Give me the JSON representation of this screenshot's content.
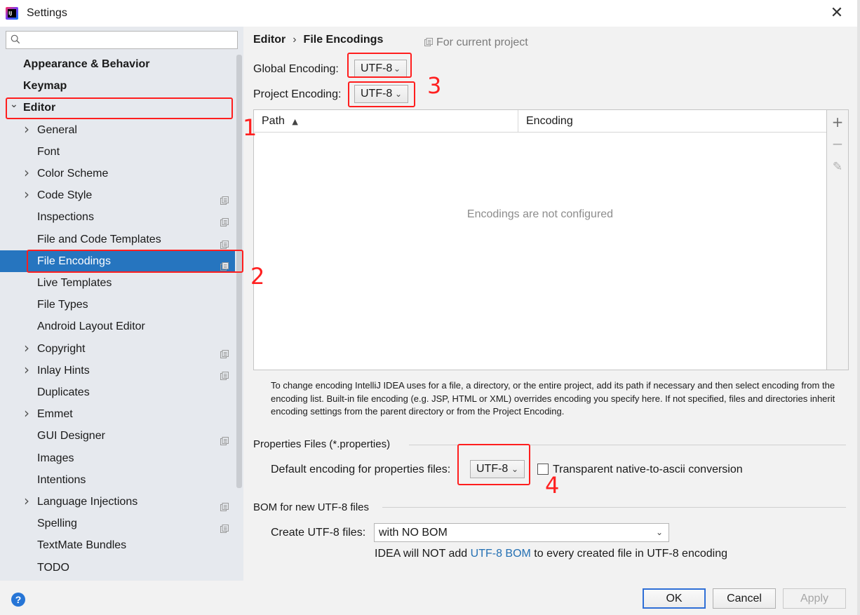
{
  "window": {
    "title": "Settings",
    "logo_text": "IJ"
  },
  "sidebar": {
    "search_placeholder": "",
    "items": [
      {
        "label": "Appearance & Behavior",
        "bold": true,
        "level": 0,
        "chevron": ""
      },
      {
        "label": "Keymap",
        "bold": true,
        "level": 0,
        "chevron": ""
      },
      {
        "label": "Editor",
        "bold": true,
        "level": 0,
        "chevron": "down"
      },
      {
        "label": "General",
        "level": 1,
        "chevron": "right"
      },
      {
        "label": "Font",
        "level": 1,
        "chevron": ""
      },
      {
        "label": "Color Scheme",
        "level": 1,
        "chevron": "right"
      },
      {
        "label": "Code Style",
        "level": 1,
        "chevron": "right",
        "project": true
      },
      {
        "label": "Inspections",
        "level": 1,
        "chevron": "",
        "project": true
      },
      {
        "label": "File and Code Templates",
        "level": 1,
        "chevron": "",
        "project": true
      },
      {
        "label": "File Encodings",
        "level": 1,
        "chevron": "",
        "project": true,
        "selected": true
      },
      {
        "label": "Live Templates",
        "level": 1,
        "chevron": ""
      },
      {
        "label": "File Types",
        "level": 1,
        "chevron": ""
      },
      {
        "label": "Android Layout Editor",
        "level": 1,
        "chevron": ""
      },
      {
        "label": "Copyright",
        "level": 1,
        "chevron": "right",
        "project": true
      },
      {
        "label": "Inlay Hints",
        "level": 1,
        "chevron": "right",
        "project": true
      },
      {
        "label": "Duplicates",
        "level": 1,
        "chevron": ""
      },
      {
        "label": "Emmet",
        "level": 1,
        "chevron": "right"
      },
      {
        "label": "GUI Designer",
        "level": 1,
        "chevron": "",
        "project": true
      },
      {
        "label": "Images",
        "level": 1,
        "chevron": ""
      },
      {
        "label": "Intentions",
        "level": 1,
        "chevron": ""
      },
      {
        "label": "Language Injections",
        "level": 1,
        "chevron": "right",
        "project": true
      },
      {
        "label": "Spelling",
        "level": 1,
        "chevron": "",
        "project": true
      },
      {
        "label": "TextMate Bundles",
        "level": 1,
        "chevron": ""
      },
      {
        "label": "TODO",
        "level": 1,
        "chevron": ""
      }
    ]
  },
  "main": {
    "breadcrumb": {
      "parent": "Editor",
      "separator": "›",
      "current": "File Encodings"
    },
    "for_current_project": "For current project",
    "global_encoding": {
      "label": "Global Encoding:",
      "value": "UTF-8"
    },
    "project_encoding": {
      "label": "Project Encoding:",
      "value": "UTF-8"
    },
    "table": {
      "columns": [
        "Path",
        "Encoding"
      ],
      "sort_indicator": "▲",
      "empty_text": "Encodings are not configured",
      "tools": {
        "add": "+",
        "remove": "−",
        "edit": "✎"
      }
    },
    "help_text": "To change encoding IntelliJ IDEA uses for a file, a directory, or the entire project, add its path if necessary and then select encoding from the encoding list. Built-in file encoding (e.g. JSP, HTML or XML) overrides encoding you specify here. If not specified, files and directories inherit encoding settings from the parent directory or from the Project Encoding.",
    "properties": {
      "section_title": "Properties Files (*.properties)",
      "default_label": "Default encoding for properties files:",
      "value": "UTF-8",
      "transparent_label": "Transparent native-to-ascii conversion",
      "transparent_checked": false
    },
    "bom": {
      "section_title": "BOM for new UTF-8 files",
      "create_label": "Create UTF-8 files:",
      "create_value": "with NO BOM",
      "note_prefix": "IDEA will NOT add ",
      "note_link": "UTF-8 BOM",
      "note_suffix": " to every created file in UTF-8 encoding"
    }
  },
  "footer": {
    "help": "?",
    "ok": "OK",
    "cancel": "Cancel",
    "apply": "Apply"
  },
  "annotations": {
    "n1": "1",
    "n2": "2",
    "n3": "3",
    "n4": "4"
  },
  "colors": {
    "selection": "#2675bf",
    "annotation_red": "#ff1e1e",
    "link": "#2470b3"
  }
}
